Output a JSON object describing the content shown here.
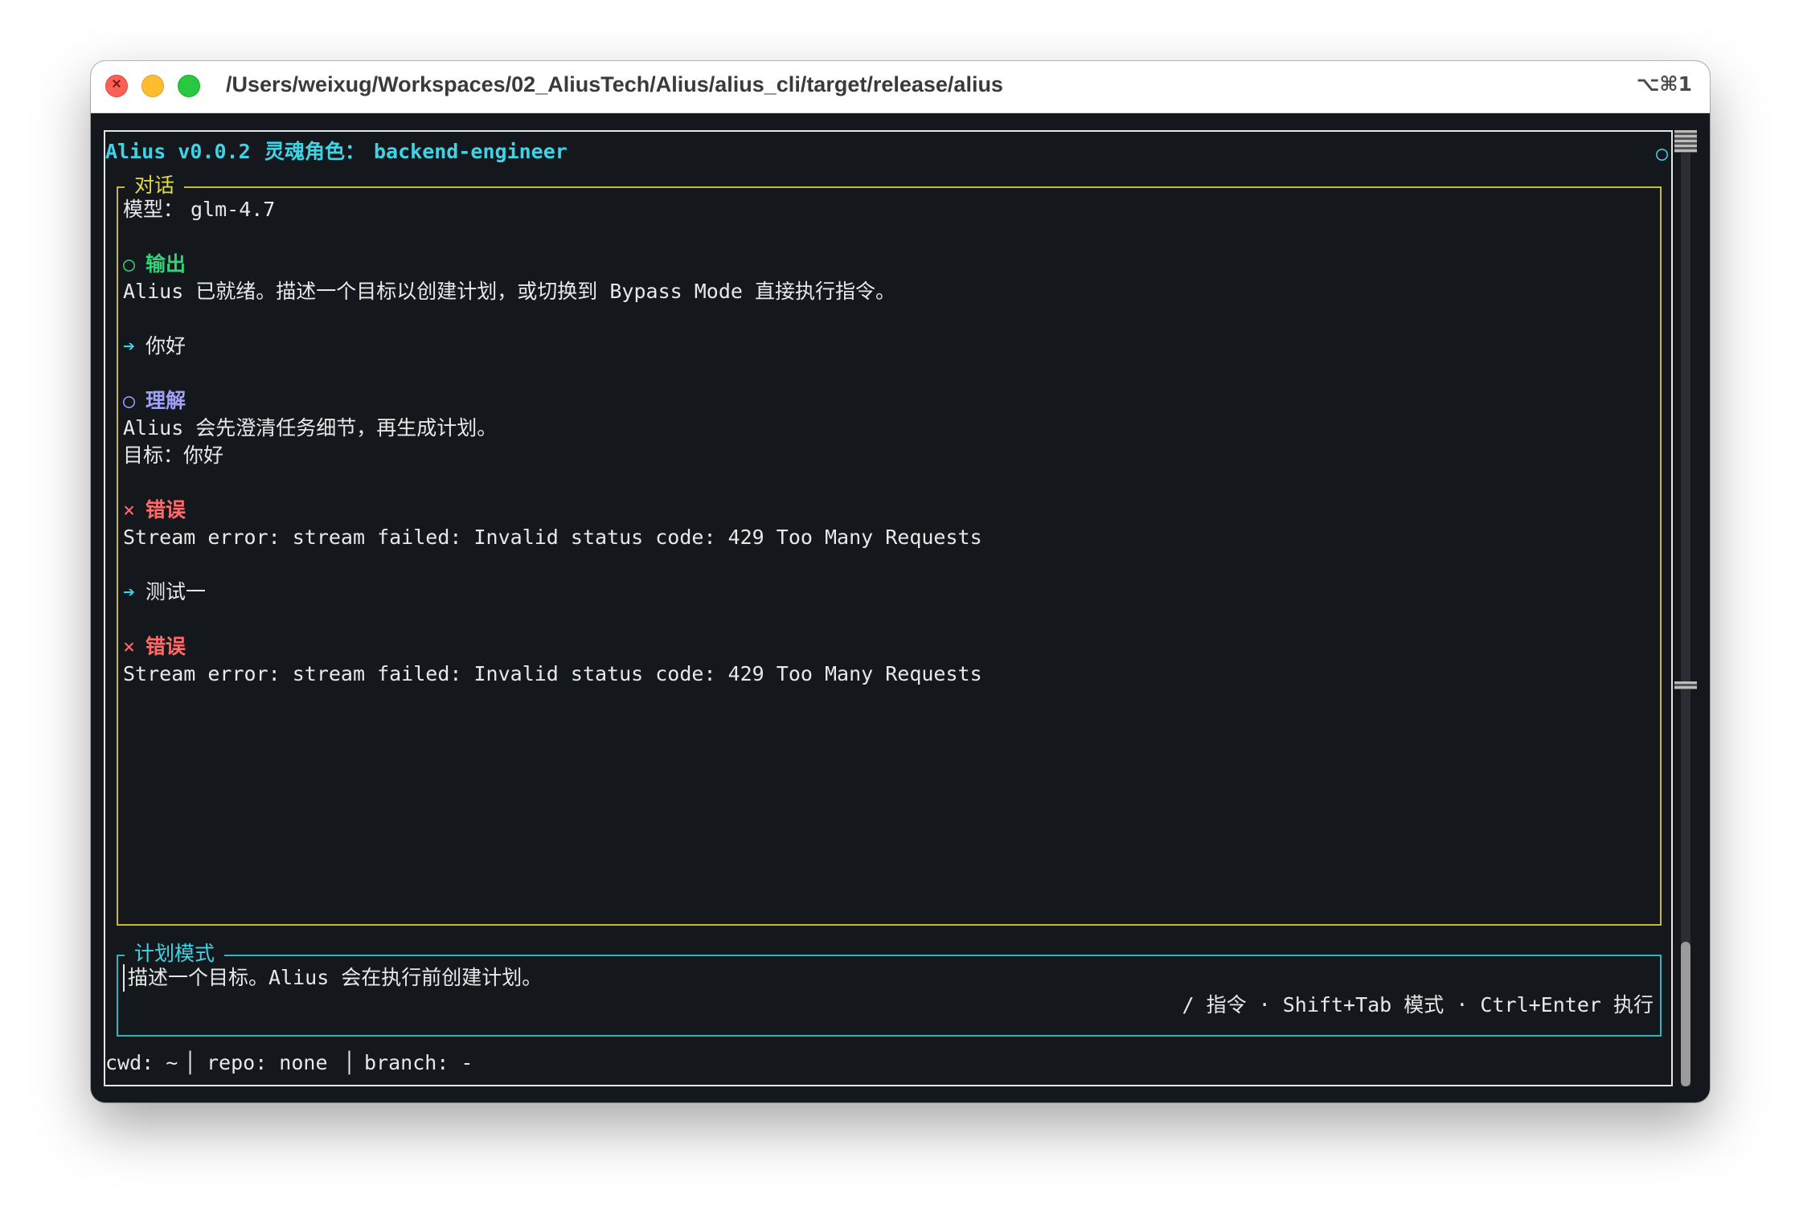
{
  "window": {
    "title": "/Users/weixug/Workspaces/02_AliusTech/Alius/alius_cli/target/release/alius",
    "shortcut": "⌥⌘1"
  },
  "header": {
    "app": "Alius v0.0.2",
    "role_label": "灵魂角色：",
    "role": "backend-engineer",
    "indicator": "○"
  },
  "dialog": {
    "label": "对话",
    "model_label": "模型：",
    "model": "glm-4.7",
    "messages": [
      {
        "kind": "output",
        "icon": "○",
        "title": "输出",
        "lines": [
          "Alius 已就绪。描述一个目标以创建计划，或切换到 Bypass Mode 直接执行指令。"
        ]
      },
      {
        "kind": "user",
        "icon": "➔",
        "text": "你好"
      },
      {
        "kind": "understand",
        "icon": "○",
        "title": "理解",
        "lines": [
          "Alius 会先澄清任务细节，再生成计划。",
          "目标：你好"
        ]
      },
      {
        "kind": "error",
        "icon": "×",
        "title": "错误",
        "lines": [
          "Stream error: stream failed: Invalid status code: 429 Too Many Requests"
        ]
      },
      {
        "kind": "user",
        "icon": "➔",
        "text": "测试一"
      },
      {
        "kind": "error",
        "icon": "×",
        "title": "错误",
        "lines": [
          "Stream error: stream failed: Invalid status code: 429 Too Many Requests"
        ]
      }
    ]
  },
  "input": {
    "label": "计划模式",
    "placeholder": "描述一个目标。Alius 会在执行前创建计划。",
    "hints": "/ 指令 · Shift+Tab 模式 · Ctrl+Enter 执行"
  },
  "status": {
    "cwd": "cwd: ~",
    "repo": "repo: none",
    "branch": "branch: -",
    "separator": "│"
  },
  "colors": {
    "background": "#14181c",
    "cyan": "#3fd3e6",
    "yellow_border": "#c9b832",
    "green": "#33d17a",
    "purple": "#9f9ff5",
    "red": "#ff6b6b"
  }
}
